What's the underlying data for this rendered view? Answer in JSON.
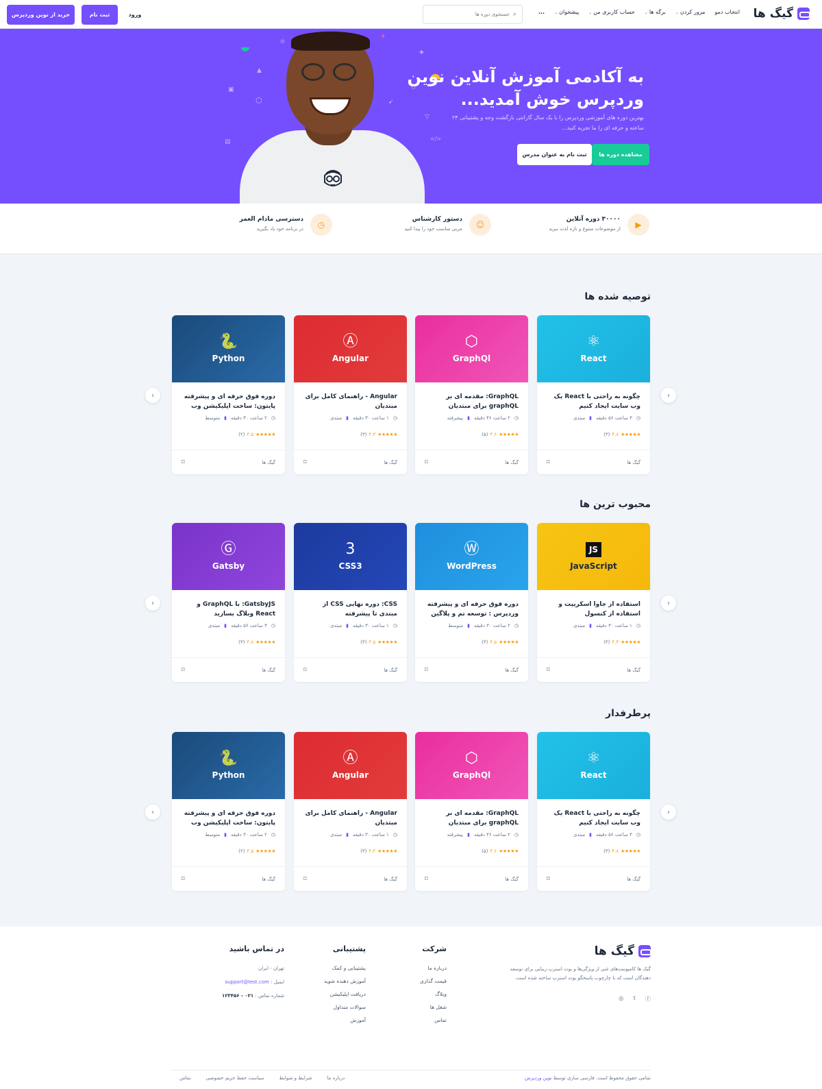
{
  "header": {
    "logo": "گیگ ها",
    "nav": [
      {
        "label": "انتخاب دمو",
        "has_dropdown": false
      },
      {
        "label": "مرور کردن",
        "has_dropdown": true
      },
      {
        "label": "برگه ها",
        "has_dropdown": true
      },
      {
        "label": "حساب کاربری من",
        "has_dropdown": true
      },
      {
        "label": "پیشخوان",
        "has_dropdown": true
      },
      {
        "label": "...",
        "has_dropdown": false
      }
    ],
    "search_placeholder": "جستجوی دوره ها",
    "login": "ورود",
    "signup": "ثبت نام",
    "buy": "خرید از نوین وردپرس"
  },
  "hero": {
    "title_line1": "به آکادمی آموزش آنلاین نوین",
    "title_line2": "وردپرس خوش آمدید...",
    "subtitle": "بهترین دوره های آموزشی وردپرس را با یک سال گارانتی بازگشت وجه و پشتیبانی ۲۴ ساعته و حرفه ای را ما تجربه کنید...",
    "btn_courses": "مشاهده دوره ها",
    "btn_instructor": "ثبت نام به عنوان مدرس"
  },
  "features": [
    {
      "icon": "video-icon",
      "title": "۳۰۰۰۰ دوره آنلاین",
      "sub": "از موضوعات متنوع و تازه لذت ببرید"
    },
    {
      "icon": "users-icon",
      "title": "دستور کارشناس",
      "sub": "مربی مناسب خود را پیدا کنید"
    },
    {
      "icon": "clock-icon",
      "title": "دسترسی مادام العمر",
      "sub": "در برنامه خود یاد بگیرید"
    }
  ],
  "sections": [
    {
      "title": "توصیه شده ها",
      "courses": [
        {
          "lang": "React",
          "icon": "react-icon",
          "bg": "linear-gradient(135deg,#22c1e8,#1ab0dc)",
          "title": "چگونه به راحتی با React یک وب سایت ایجاد کنیم",
          "duration": "۳ ساعت ۵۶ دقیقه",
          "level": "مبتدی",
          "stars": "★★★★★",
          "rating": "۴.۸",
          "reviews": "(۳)",
          "author": "گیگ ها"
        },
        {
          "lang": "GraphQl",
          "icon": "graphql-icon",
          "bg": "linear-gradient(135deg,#ea2e9d,#f056b8)",
          "title": "GraphQL: مقدمه ای بر graphQL برای مبتدیان",
          "duration": "۲ ساعت ۴۶ دقیقه",
          "level": "پیشرفته",
          "stars": "★★★★★",
          "rating": "۴.۶",
          "reviews": "(۵)",
          "author": "گیگ ها"
        },
        {
          "lang": "Angular",
          "icon": "angular-icon",
          "bg": "linear-gradient(135deg,#dd2c32,#e23b3b)",
          "title": "Angular - راهنمای کامل برای مبتدیان",
          "duration": "۱ ساعت ۳۰ دقیقه",
          "level": "مبتدی",
          "stars": "★★★★★",
          "rating": "۴.۳",
          "reviews": "(۳)",
          "author": "گیگ ها"
        },
        {
          "lang": "Python",
          "icon": "python-icon",
          "bg": "linear-gradient(135deg,#1a4a7a,#2a6aa8)",
          "title": "دوره فوق حرفه ای و پیشرفته پایتون: ساخت اپلیکیشن وب",
          "duration": "۲ ساعت ۳۰ دقیقه",
          "level": "متوسط",
          "stars": "★★★★★",
          "rating": "۴.۵",
          "reviews": "(۲)",
          "author": "گیگ ها"
        }
      ]
    },
    {
      "title": "محبوب ترین ها",
      "courses": [
        {
          "lang": "JavaScript",
          "icon": "js-icon",
          "bg": "linear-gradient(135deg,#f7c514,#f5b80b)",
          "title": "استفاده از جاوا اسکریپت و استفاده از کنسول",
          "duration": "۱ ساعت ۳۰ دقیقه",
          "level": "مبتدی",
          "stars": "★★★★★",
          "rating": "۴.۳",
          "reviews": "(۳)",
          "author": "گیگ ها"
        },
        {
          "lang": "WordPress",
          "icon": "wordpress-icon",
          "bg": "linear-gradient(135deg,#1f8fdd,#29a4ec)",
          "title": "دوره فوق حرفه ای و پیشرفته وردپرس : توسعه تم و پلاگین",
          "duration": "۲ ساعت ۳۰ دقیقه",
          "level": "متوسط",
          "stars": "★★★★★",
          "rating": "۴.۵",
          "reviews": "(۳)",
          "author": "گیگ ها"
        },
        {
          "lang": "CSS3",
          "icon": "css3-icon",
          "bg": "linear-gradient(135deg,#1d3a9e,#2447b8)",
          "title": "CSS: دوره نهایی CSS از مبتدی تا پیشرفته",
          "duration": "۱ ساعت ۳۰ دقیقه",
          "level": "مبتدی",
          "stars": "★★★★★",
          "rating": "۴.۵",
          "reviews": "(۳)",
          "author": "گیگ ها"
        },
        {
          "lang": "Gatsby",
          "icon": "gatsby-icon",
          "bg": "linear-gradient(135deg,#7a34c9,#8f45dc)",
          "title": "GatsbyJS: با GraphQL و React وبلاگ بسازید",
          "duration": "۳ ساعت ۵۶ دقیقه",
          "level": "مبتدی",
          "stars": "★★★★★",
          "rating": "۴.۸",
          "reviews": "(۳)",
          "author": "گیگ ها"
        }
      ]
    },
    {
      "title": "پرطرفدار",
      "courses": [
        {
          "lang": "React",
          "icon": "react-icon",
          "bg": "linear-gradient(135deg,#22c1e8,#1ab0dc)",
          "title": "چگونه به راحتی با React یک وب سایت ایجاد کنیم",
          "duration": "۳ ساعت ۵۶ دقیقه",
          "level": "مبتدی",
          "stars": "★★★★★",
          "rating": "۴.۸",
          "reviews": "(۳)",
          "author": "گیگ ها"
        },
        {
          "lang": "GraphQl",
          "icon": "graphql-icon",
          "bg": "linear-gradient(135deg,#ea2e9d,#f056b8)",
          "title": "GraphQL: مقدمه ای بر graphQL برای مبتدیان",
          "duration": "۲ ساعت ۴۶ دقیقه",
          "level": "پیشرفته",
          "stars": "★★★★★",
          "rating": "۴.۶",
          "reviews": "(۵)",
          "author": "گیگ ها"
        },
        {
          "lang": "Angular",
          "icon": "angular-icon",
          "bg": "linear-gradient(135deg,#dd2c32,#e23b3b)",
          "title": "Angular - راهنمای کامل برای مبتدیان",
          "duration": "۱ ساعت ۳۰ دقیقه",
          "level": "مبتدی",
          "stars": "★★★★★",
          "rating": "۴.۳",
          "reviews": "(۳)",
          "author": "گیگ ها"
        },
        {
          "lang": "Python",
          "icon": "python-icon",
          "bg": "linear-gradient(135deg,#1a4a7a,#2a6aa8)",
          "title": "دوره فوق حرفه ای و پیشرفته پایتون: ساخت اپلیکیشن وب",
          "duration": "۲ ساعت ۳۰ دقیقه",
          "level": "متوسط",
          "stars": "★★★★★",
          "rating": "۴.۵",
          "reviews": "(۲)",
          "author": "گیگ ها"
        }
      ]
    }
  ],
  "footer": {
    "logo": "گیگ ها",
    "about": "گیک ها کامپوننت‌های غنی از ویژگی‌ها و بوت استرپ زیبایی برای توسعه دهندگان است که با چارچوب پاسخگو بوت استرپ ساخته شده است.",
    "company": {
      "title": "شرکت",
      "links": [
        "درباره ما",
        "قیمت گذاری",
        "وبلاگ",
        "شغل ها",
        "تماس"
      ]
    },
    "support": {
      "title": "پشتیبانی",
      "links": [
        "پشتیبانی و کمک",
        "آموزش دهنده شوید",
        "دریافت اپلیکیشن",
        "سوالات متداول",
        "آموزش"
      ]
    },
    "contact": {
      "title": "در تماس باشید",
      "address": "تهران - ایران",
      "email_label": "ایمیل :",
      "email": "support@test.com",
      "phone_label": "شماره تماس :",
      "phone": "۰۲۱ - ۱۲۳۴۵۶"
    },
    "copyright_prefix": "تمامی حقوق محفوظ است. فارسی سازی توسط",
    "copyright_link": "نوین وردپرس",
    "bottom_links": [
      "درباره ما",
      "شرایط و ضوابط",
      "سیاست حفظ حریم خصوصی",
      "تماس"
    ]
  },
  "colors": {
    "primary": "#754ffe",
    "success": "#19cb98",
    "star": "#f59e0b"
  }
}
